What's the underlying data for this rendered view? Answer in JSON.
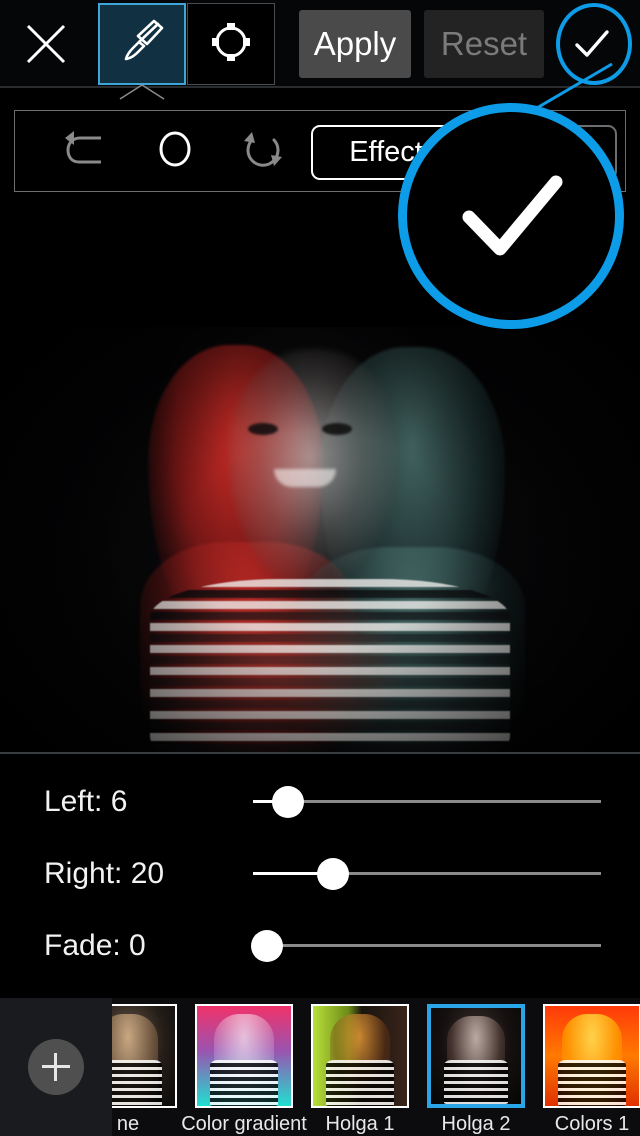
{
  "topbar": {
    "close_icon": "close-x-icon",
    "tabs": [
      {
        "name": "brush-tool",
        "icon": "paintbrush-icon",
        "selected": true
      },
      {
        "name": "shape-mask-tool",
        "icon": "circle-handles-icon",
        "selected": false
      }
    ],
    "apply_label": "Apply",
    "reset_label": "Reset",
    "confirm_icon": "checkmark-icon"
  },
  "subtoolbar": {
    "undo_icon": "undo-arrow-icon",
    "brush_size_icon": "brush-size-circle-icon",
    "redo_icon": "redo-refresh-icon",
    "effect_label": "Effect",
    "second_button_label": ""
  },
  "canvas": {
    "gear_icon": "settings-gear-icon",
    "grip_icon": "drag-grip-icon"
  },
  "sliders": [
    {
      "name": "left-slider",
      "label": "Left: 6",
      "value": 6,
      "percent": 10
    },
    {
      "name": "right-slider",
      "label": "Right: 20",
      "value": 20,
      "percent": 23
    },
    {
      "name": "fade-slider",
      "label": "Fade: 0",
      "value": 0,
      "percent": 4
    }
  ],
  "filmstrip": {
    "add_button_icon": "plus-icon",
    "items": [
      {
        "label": "ne",
        "selected": false,
        "style": "none"
      },
      {
        "label": "Color gradient",
        "selected": false,
        "style": "gradient"
      },
      {
        "label": "Holga 1",
        "selected": false,
        "style": "holga1"
      },
      {
        "label": "Holga 2",
        "selected": true,
        "style": "holga2"
      },
      {
        "label": "Colors 1",
        "selected": false,
        "style": "colors1"
      }
    ]
  },
  "callout": {
    "ring_color": "#0d9ce8",
    "magnified_icon": "checkmark-icon"
  }
}
